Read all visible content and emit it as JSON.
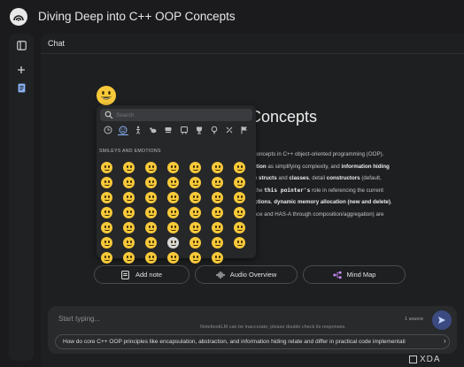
{
  "app": {
    "title": "Diving Deep into C++ OOP Concepts"
  },
  "chat": {
    "label": "Chat"
  },
  "notebook": {
    "title_visible": "Concepts",
    "summary_lines": [
      {
        "segs": [
          {
            "t": "al concepts in C++ object-oriented programming (OOP).",
            "s": "n"
          }
        ]
      },
      {
        "segs": [
          {
            "t": "raction",
            "s": "b"
          },
          {
            "t": " as simplifying complexity, and ",
            "s": "n"
          },
          {
            "t": "information hiding",
            "s": "b"
          }
        ]
      },
      {
        "segs": [
          {
            "t": "een ",
            "s": "n"
          },
          {
            "t": "structs",
            "s": "b"
          },
          {
            "t": " and ",
            "s": "n"
          },
          {
            "t": "classes",
            "s": "b"
          },
          {
            "t": ", detail ",
            "s": "n"
          },
          {
            "t": "constructors",
            "s": "b"
          },
          {
            "t": " (default,",
            "s": "n"
          }
        ]
      },
      {
        "segs": [
          {
            "t": "ify the ",
            "s": "n"
          },
          {
            "t": "this pointer's",
            "s": "c"
          },
          {
            "t": " role in referencing the current",
            "s": "n"
          }
        ]
      },
      {
        "segs": [
          {
            "t": "unctions",
            "s": "b"
          },
          {
            "t": ", ",
            "s": "n"
          },
          {
            "t": "dynamic memory allocation (new and delete)",
            "s": "b"
          },
          {
            "t": ",",
            "s": "n"
          }
        ]
      },
      {
        "segs": [
          {
            "t": "itance and HAS-A through composition/aggregation) are",
            "s": "n"
          }
        ]
      }
    ]
  },
  "emoji_picker": {
    "search_placeholder": "Search",
    "category_title": "SMILEYS AND EMOTIONS",
    "categories": [
      "clock-icon",
      "smiley-icon",
      "person-icon",
      "animal-icon",
      "food-icon",
      "travel-icon",
      "activity-icon",
      "lightbulb-icon",
      "symbols-icon",
      "flag-icon"
    ],
    "active_category": 1,
    "grid": [
      [
        "#f7c93a",
        "#f7c93a",
        "#f7c93a",
        "#f7c93a",
        "#f7c93a",
        "#f7c93a",
        "#f7c93a",
        "#f7c93a"
      ],
      [
        "#f7c93a",
        "#f7c93a",
        "#f7c93a",
        "#f7c93a",
        "#f7c93a",
        "#f7c93a",
        "#f7c93a",
        "#f7c93a"
      ],
      [
        "#f7c93a",
        "#f7c93a",
        "#f7c93a",
        "#f7c93a",
        "#f7c93a",
        "#f7c93a",
        "#f7c93a",
        "#f7c93a"
      ],
      [
        "#f7c93a",
        "#f7c93a",
        "#f7c93a",
        "#f7c93a",
        "#f7c93a",
        "#f7c93a",
        "#f7c93a",
        "#f7c93a"
      ],
      [
        "#f7c93a",
        "#f7c93a",
        "#f7c93a",
        "#f7c93a",
        "#f7c93a",
        "#f7c93a",
        "#d9d9d9",
        "#f7c93a"
      ],
      [
        "#f7c93a",
        "#f7c93a",
        "#f7c93a",
        "#f7c93a",
        "#f7c93a",
        "#f7c93a",
        "#f7c93a",
        "#f7c93a"
      ]
    ]
  },
  "actions": [
    {
      "label": "Add note",
      "icon": "note-icon",
      "width": 108
    },
    {
      "label": "Audio Overview",
      "icon": "audio-wave-icon",
      "width": 116
    },
    {
      "label": "Mind Map",
      "icon": "mind-map-icon",
      "width": 116
    }
  ],
  "composer": {
    "placeholder": "Start typing...",
    "source_count": "1 source",
    "suggestion": "How do core C++ OOP principles like encapsulation, abstraction, and information hiding relate and differ in practical code implementati"
  },
  "disclaimer": "NotebookLM can be inaccurate; please double check its responses.",
  "watermark": "XDA",
  "colors": {
    "accent": "#8ab4f8",
    "send": "#3b4a80",
    "emoji": "#f7c93a"
  }
}
